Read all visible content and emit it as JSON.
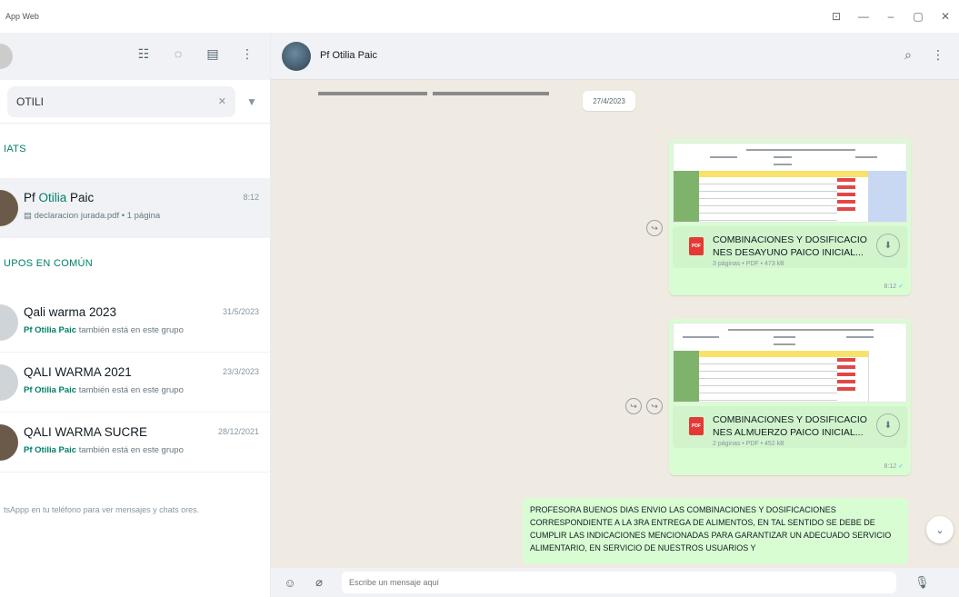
{
  "window": {
    "title": "App Web",
    "controls": [
      "⊡",
      "—",
      "–",
      "▢",
      "✕"
    ]
  },
  "sidebar": {
    "header_icons": [
      "community-icon",
      "status-icon",
      "new-chat-icon",
      "menu-icon"
    ],
    "search": {
      "value": "OTILI",
      "clear": "✕",
      "filter": "▼"
    },
    "section_chats": "IATS",
    "chats": [
      {
        "name_prefix": "Pf ",
        "name_highlight": "Otilia",
        "name_suffix": " Paic",
        "time": "8:12",
        "preview": "▤ declaracion jurada.pdf • 1 página"
      }
    ],
    "section_groups": "UPOS EN COMÚN",
    "groups": [
      {
        "name": "Qali warma 2023",
        "date": "31/5/2023",
        "member": "Pf Otilia Paic",
        "preview": " también está en este grupo"
      },
      {
        "name": "QALI WARMA 2021",
        "date": "23/3/2023",
        "member": "Pf Otilia Paic",
        "preview": " también está en este grupo"
      },
      {
        "name": "QALI WARMA SUCRE",
        "date": "28/12/2021",
        "member": "Pf Otilia Paic",
        "preview": " también está en este grupo"
      }
    ],
    "footnote": "tsAppp en tu teléfono para ver mensajes y chats ores."
  },
  "conversation": {
    "contact_name": "Pf Otilia Paic",
    "header_icons": [
      "search-icon",
      "menu-icon"
    ],
    "date_chip": "27/4/2023",
    "documents": [
      {
        "name": "COMBINACIONES Y DOSIFICACIO NES DESAYUNO PAICO INICIAL...",
        "meta": "3 páginas • PDF • 473 kB",
        "time": "8:12",
        "ticks": "✓"
      },
      {
        "name": "COMBINACIONES Y DOSIFICACIO NES ALMUERZO PAICO INICIAL...",
        "meta": "2 páginas • PDF • 452 kB",
        "time": "8:12",
        "ticks": "✓"
      }
    ],
    "text_message": "PROFESORA BUENOS DIAS ENVIO LAS COMBINACIONES Y DOSIFICACIONES CORRESPONDIENTE A LA 3RA ENTREGA DE ALIMENTOS, EN TAL SENTIDO SE DEBE DE CUMPLIR LAS INDICACIONES MENCIONADAS PARA GARANTIZAR UN ADECUADO SERVICIO ALIMENTARIO, EN SERVICIO DE NUESTROS USUARIOS Y",
    "composer_placeholder": "Escribe un mensaje aquí"
  },
  "colors": {
    "accent": "#008069",
    "bubble_out": "#d9fdd3",
    "chat_bg": "#efeae2",
    "pdf_red": "#e53935"
  }
}
